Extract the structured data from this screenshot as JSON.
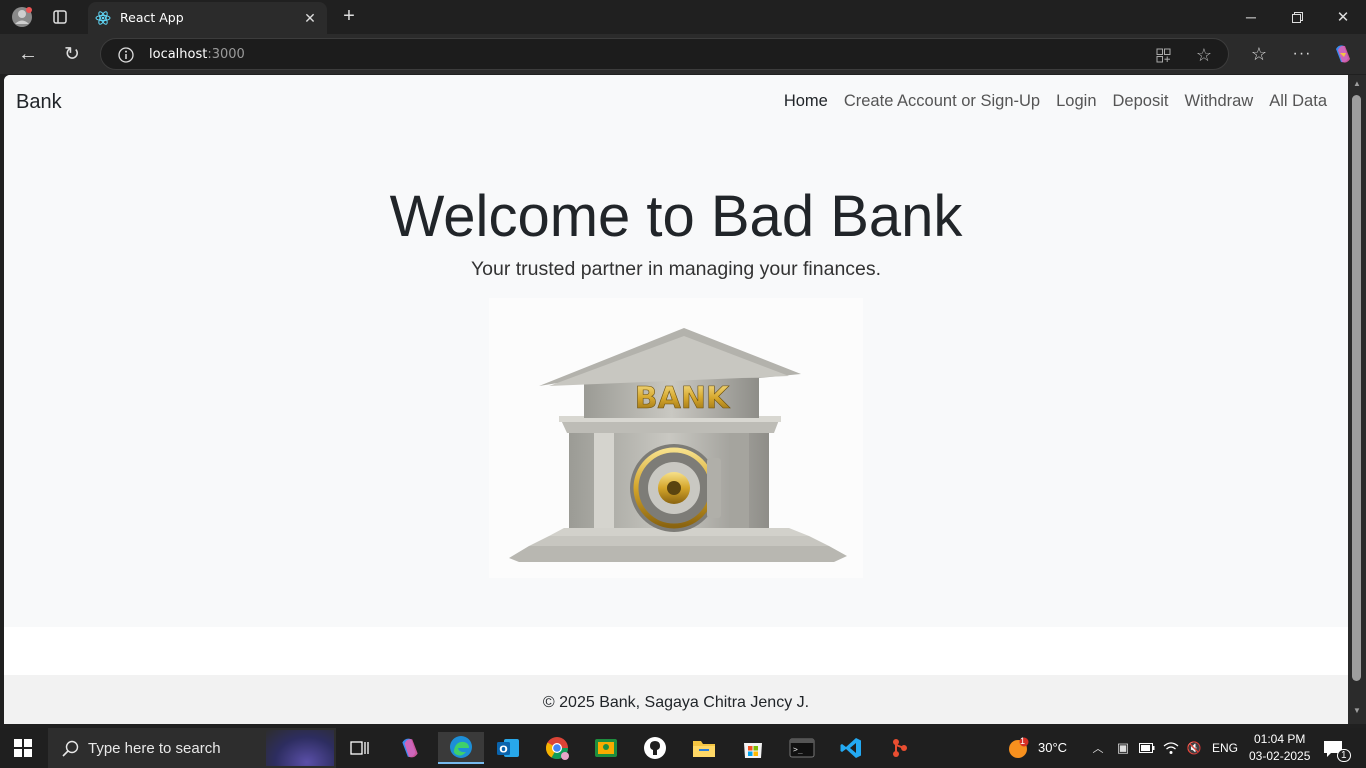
{
  "browser": {
    "tab_title": "React App",
    "url_host": "localhost",
    "url_port": ":3000"
  },
  "navbar": {
    "brand": "Bank",
    "links": [
      "Home",
      "Create Account or Sign-Up",
      "Login",
      "Deposit",
      "Withdraw",
      "All Data"
    ]
  },
  "hero": {
    "title": "Welcome to Bad Bank",
    "subtitle": "Your trusted partner in managing your finances.",
    "image_text": "BANK"
  },
  "footer": {
    "text": "© 2025 Bank, Sagaya Chitra Jency J."
  },
  "taskbar": {
    "search_placeholder": "Type here to search",
    "weather": "30°C",
    "language": "ENG",
    "time": "01:04 PM",
    "date": "03-02-2025",
    "notification_count": "1",
    "weather_badge": "1"
  }
}
